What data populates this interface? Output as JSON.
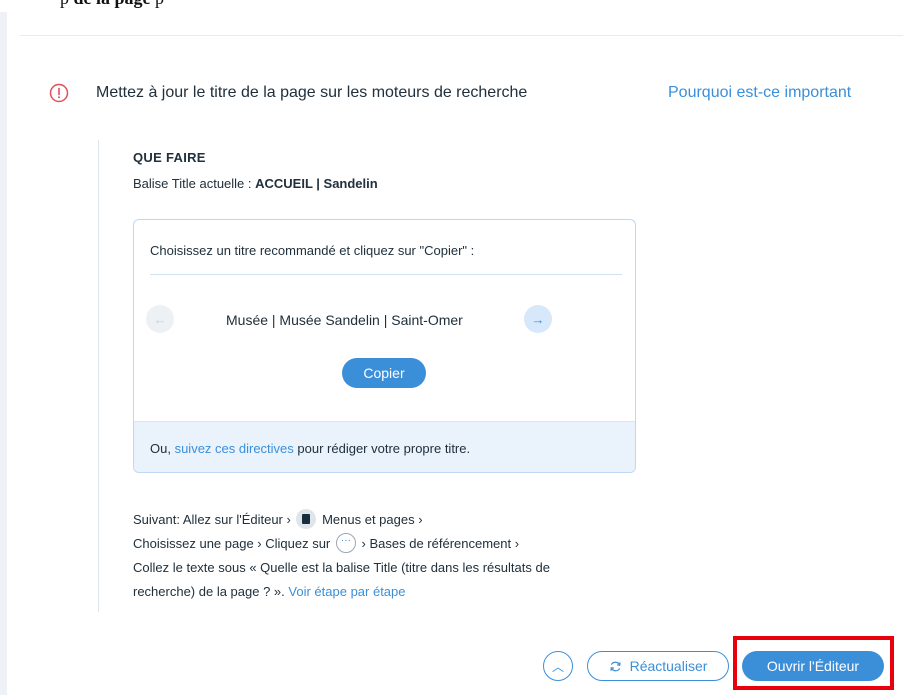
{
  "top_strip": {
    "text_before": "p",
    "text_bold": "de la page",
    "text_after": "p"
  },
  "issue": {
    "icon": "alert-circle-icon",
    "title": "Mettez à jour le titre de la page sur les moteurs de recherche",
    "why_link": "Pourquoi est-ce important"
  },
  "what_to_do": {
    "heading": "QUE FAIRE",
    "current_prefix": "Balise Title actuelle : ",
    "current_value": "ACCUEIL | Sandelin"
  },
  "card": {
    "prompt": "Choisissez un titre recommandé et cliquez sur \"Copier\" :",
    "suggestion": "Musée | Musée Sandelin | Saint-Omer",
    "prev_icon": "arrow-left-icon",
    "next_icon": "arrow-right-icon",
    "copy_label": "Copier",
    "footer_prefix": "Ou, ",
    "footer_link": "suivez ces directives",
    "footer_suffix": " pour rédiger votre propre titre."
  },
  "steps": {
    "line1_a": "Suivant: Allez sur l'Éditeur ›",
    "line1_b": "Menus et pages ›",
    "line2_a": "Choisissez une page › Cliquez sur",
    "line2_b": "› Bases de référencement ›",
    "line3": "Collez le texte sous « Quelle est la balise Title (titre dans les résultats de",
    "line4_a": "recherche) de la page ? ».",
    "line4_link": "Voir étape par étape"
  },
  "footer": {
    "collapse_icon": "chevron-up-icon",
    "refresh_icon": "refresh-icon",
    "refresh_label": "Réactualiser",
    "open_editor_label": "Ouvrir l'Éditeur"
  },
  "colors": {
    "accent": "#3b8fd9",
    "alert": "#e0505a",
    "highlight": "#e8000d",
    "text": "#20303c"
  }
}
